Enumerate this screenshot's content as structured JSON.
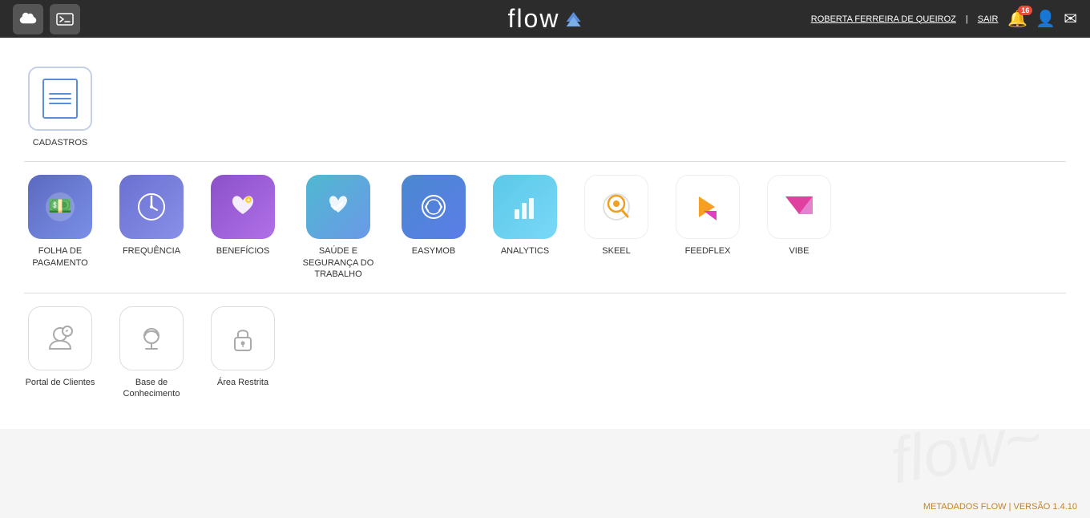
{
  "header": {
    "logo": "flow",
    "user": "ROBERTA FERREIRA DE QUEIROZ",
    "separator": "|",
    "sair": "SAIR",
    "notif_count": "16"
  },
  "sections": {
    "section1": {
      "items": [
        {
          "id": "cadastros",
          "label": "CADASTROS",
          "type": "cadastros"
        }
      ]
    },
    "section2": {
      "items": [
        {
          "id": "folha",
          "label": "FOLHA DE PAGAMENTO",
          "type": "grad-blue",
          "icon": "💰"
        },
        {
          "id": "frequencia",
          "label": "FREQUÊNCIA",
          "type": "grad-blue",
          "icon": "🕐"
        },
        {
          "id": "beneficios",
          "label": "BENEFÍCIOS",
          "type": "grad-pink-purple",
          "icon": "❤"
        },
        {
          "id": "saude",
          "label": "SAÚDE E SEGURANÇA DO TRABALHO",
          "type": "grad-teal-blue",
          "icon": "💓"
        },
        {
          "id": "easymob",
          "label": "EASYMOB",
          "type": "grad-blue2",
          "icon": "⟳"
        },
        {
          "id": "analytics",
          "label": "ANALYTICS",
          "type": "grad-cyan",
          "icon": "📊"
        },
        {
          "id": "skeel",
          "label": "SKEEL",
          "type": "skeel",
          "icon": "🔍"
        },
        {
          "id": "feedflex",
          "label": "FEEDFLEX",
          "type": "feedflex",
          "icon": "▶"
        },
        {
          "id": "vibe",
          "label": "VIBE",
          "type": "vibe",
          "icon": "▽"
        }
      ]
    },
    "section3": {
      "items": [
        {
          "id": "portal",
          "label": "Portal de Clientes",
          "type": "gray-gear"
        },
        {
          "id": "base",
          "label": "Base de Conhecimento",
          "type": "gray-hat"
        },
        {
          "id": "restrita",
          "label": "Área Restrita",
          "type": "gray-lock"
        }
      ]
    }
  },
  "footer": {
    "text": "METADADOS FLOW | VERSÃO 1.4.10"
  }
}
